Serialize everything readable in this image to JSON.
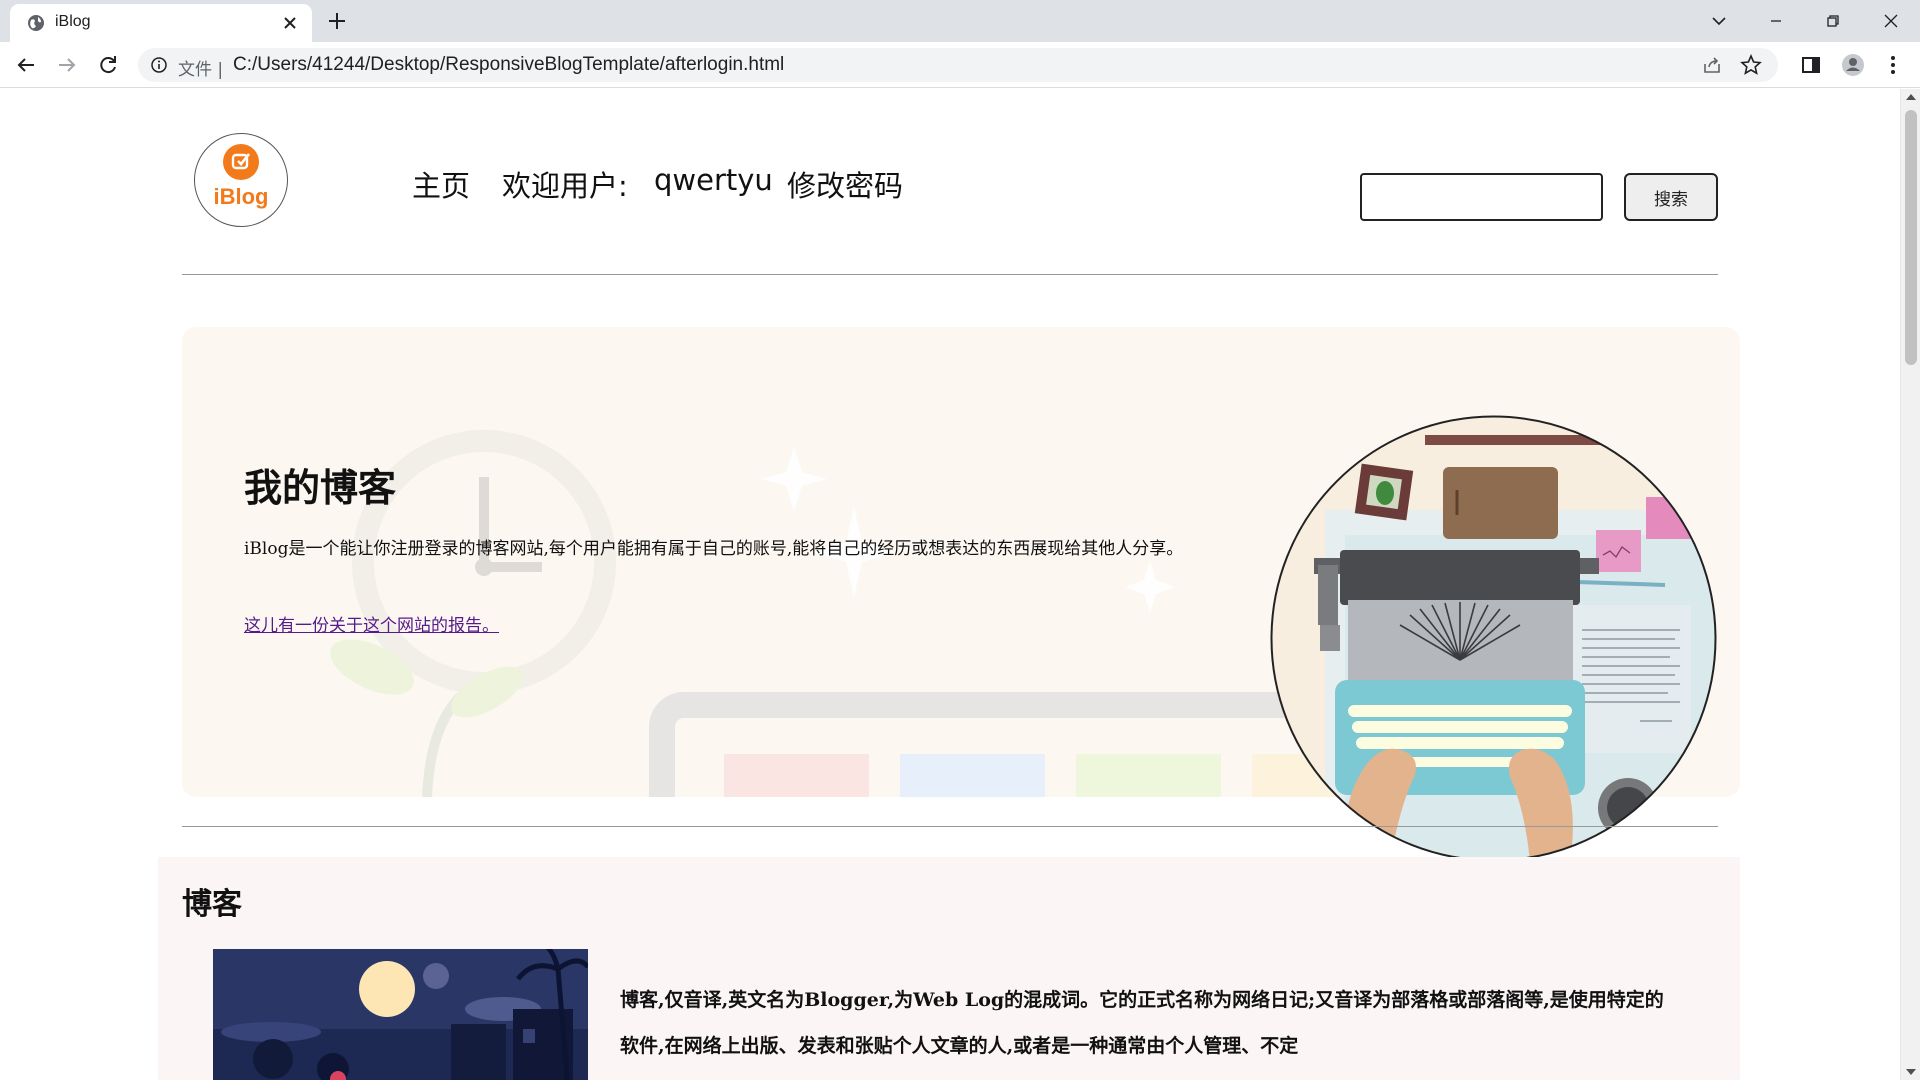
{
  "browser": {
    "tab_title": "iBlog",
    "omnibox_chip": "文件 |",
    "url": "C:/Users/41244/Desktop/ResponsiveBlogTemplate/afterlogin.html"
  },
  "header": {
    "logo_text": "iBlog",
    "nav": {
      "home": "主页",
      "welcome": "欢迎用户:",
      "username": "qwertyu",
      "change_password": "修改密码"
    },
    "search": {
      "value": "",
      "placeholder": "",
      "button_label": "搜索"
    }
  },
  "hero": {
    "title": "我的博客",
    "description": "iBlog是一个能让你注册登录的博客网站,每个用户能拥有属于自己的账号,能将自己的经历或想表达的东西展现给其他人分享。",
    "report_link": "这儿有一份关于这个网站的报告。"
  },
  "blog": {
    "heading": "博客",
    "text": "博客,仅音译,英文名为Blogger,为Web Log的混成词。它的正式名称为网络日记;又音译为部落格或部落阁等,是使用特定的软件,在网络上出版、发表和张贴个人文章的人,或者是一种通常由个人管理、不定"
  },
  "colors": {
    "brand_orange": "#f27a1a",
    "hero_bg": "#fcf7f1",
    "section_bg": "#fbf6f5",
    "visited_link": "#551a8b"
  }
}
